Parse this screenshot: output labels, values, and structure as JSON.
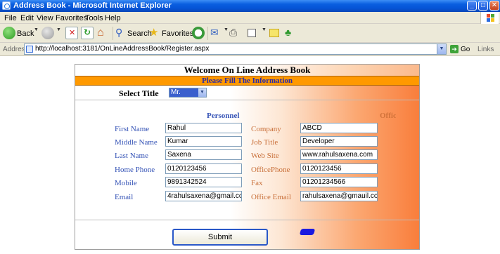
{
  "window": {
    "title": "Address Book - Microsoft Internet Explorer",
    "buttons": [
      "_",
      "□",
      "✕"
    ]
  },
  "menu": [
    "File",
    "Edit",
    "View",
    "Favorites",
    "Tools",
    "Help"
  ],
  "toolbar": {
    "back_label": "Back",
    "search_label": "Search",
    "favorites_label": "Favorites"
  },
  "address_bar": {
    "label": "Address",
    "url": "http://localhost:3181/OnLineAddressBook/Register.aspx",
    "go_label": "Go",
    "links_label": "Links"
  },
  "form": {
    "heading": "Welcome On Line Address Book",
    "subheading": "Please Fill The Information",
    "title_label": "Select Title",
    "title_value": "Mr.",
    "personnel_heading": "Personnel",
    "office_heading": "Offici",
    "personal_fields": [
      {
        "label": "First Name",
        "value": "Rahul"
      },
      {
        "label": "Middle Name",
        "value": "Kumar"
      },
      {
        "label": "Last Name",
        "value": "Saxena"
      },
      {
        "label": "Home Phone",
        "value": "0120123456"
      },
      {
        "label": "Mobile",
        "value": "9891342524"
      },
      {
        "label": "Email",
        "value": "4rahulsaxena@gmail.com"
      }
    ],
    "office_fields": [
      {
        "label": "Company",
        "value": "ABCD"
      },
      {
        "label": "Job Title",
        "value": "Developer"
      },
      {
        "label": "Web Site",
        "value": "www.rahulsaxena.com"
      },
      {
        "label": "OfficePhone",
        "value": "0120123456"
      },
      {
        "label": "Fax",
        "value": "01201234566"
      },
      {
        "label": "Office Email",
        "value": "rahulsaxena@gmauil.com"
      }
    ],
    "submit_label": "Submit"
  }
}
